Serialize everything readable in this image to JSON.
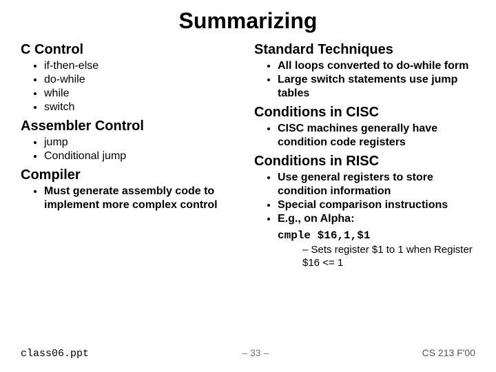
{
  "title": "Summarizing",
  "left": {
    "sec1": {
      "heading": "C Control",
      "items": [
        "if-then-else",
        "do-while",
        "while",
        "switch"
      ]
    },
    "sec2": {
      "heading": "Assembler Control",
      "items": [
        "jump",
        "Conditional jump"
      ]
    },
    "sec3": {
      "heading": "Compiler",
      "items": [
        "Must generate assembly code to implement more complex control"
      ]
    }
  },
  "right": {
    "sec1": {
      "heading": "Standard Techniques",
      "items": [
        "All loops converted to do-while form",
        "Large switch statements use jump tables"
      ]
    },
    "sec2": {
      "heading": "Conditions in CISC",
      "items": [
        "CISC machines generally have condition code registers"
      ]
    },
    "sec3": {
      "heading": "Conditions in RISC",
      "items": [
        "Use general registers to store condition information",
        "Special comparison instructions",
        "E.g., on Alpha:"
      ],
      "code_line": "cmple $16,1,$1",
      "sub": [
        "Sets register $1 to 1 when Register $16 <= 1"
      ]
    }
  },
  "footer": {
    "filename": "class06.ppt",
    "page": "– 33 –",
    "course": "CS 213 F'00"
  }
}
